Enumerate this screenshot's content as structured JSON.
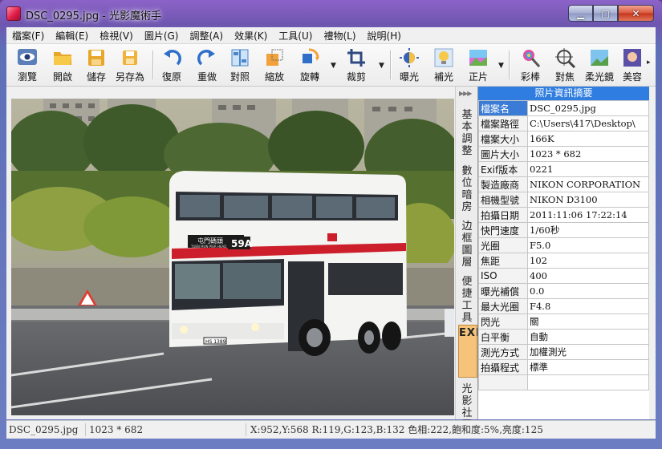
{
  "window": {
    "title": "DSC_0295.jpg - 光影魔術手"
  },
  "menu": [
    "檔案(F)",
    "編輯(E)",
    "檢視(V)",
    "圖片(G)",
    "調整(A)",
    "效果(K)",
    "工具(U)",
    "禮物(L)",
    "說明(H)"
  ],
  "toolbar": {
    "browse": "瀏覽",
    "open": "開啟",
    "save": "儲存",
    "save_as": "另存為",
    "undo": "復原",
    "redo": "重做",
    "compare": "對照",
    "resize": "縮放",
    "rotate": "旋轉",
    "crop": "裁剪",
    "exposure": "曝光",
    "fill_light": "補光",
    "positive": "正片",
    "color_pencil": "彩棒",
    "focus": "對焦",
    "soft_lens": "柔光鏡",
    "beauty": "美容"
  },
  "side_tabs": [
    "基本調整",
    "數位暗房",
    "边框圖層",
    "便捷工具",
    "EXIF",
    "光影社區"
  ],
  "info_panel": {
    "title": "照片資訊摘要",
    "rows": [
      {
        "k": "檔案名",
        "v": "DSC_0295.jpg"
      },
      {
        "k": "檔案路徑",
        "v": "C:\\Users\\417\\Desktop\\"
      },
      {
        "k": "檔案大小",
        "v": "166K"
      },
      {
        "k": "圖片大小",
        "v": "1023 * 682"
      },
      {
        "k": "Exif版本",
        "v": "0221"
      },
      {
        "k": "製造廠商",
        "v": "NIKON CORPORATION"
      },
      {
        "k": "相機型號",
        "v": "NIKON D3100"
      },
      {
        "k": "拍攝日期",
        "v": "2011:11:06 17:22:14"
      },
      {
        "k": "快門速度",
        "v": "1/60秒"
      },
      {
        "k": "光圈",
        "v": "F5.0"
      },
      {
        "k": "焦距",
        "v": "102"
      },
      {
        "k": "ISO",
        "v": "400"
      },
      {
        "k": "曝光補償",
        "v": "0.0"
      },
      {
        "k": "最大光圈",
        "v": "F4.8"
      },
      {
        "k": "閃光",
        "v": "關"
      },
      {
        "k": "白平衡",
        "v": "自動"
      },
      {
        "k": "測光方式",
        "v": "加權測光"
      },
      {
        "k": "拍攝程式",
        "v": "標準"
      },
      {
        "k": "",
        "v": ""
      }
    ]
  },
  "photo": {
    "bus_sign": "屯門碼頭",
    "bus_sign_en": "TUEN MUN PIER HEAD",
    "route": "59A",
    "plate": "HS 1389"
  },
  "status": {
    "file": "DSC_0295.jpg",
    "size": "1023 * 682",
    "pixel": "X:952,Y:568 R:119,G:123,B:132 色相:222,飽和度:5%,亮度:125"
  },
  "colors": {
    "title_accent": "#2f7de0",
    "active_tab": "#f5c37a",
    "bus_red": "#cc1f2b"
  }
}
